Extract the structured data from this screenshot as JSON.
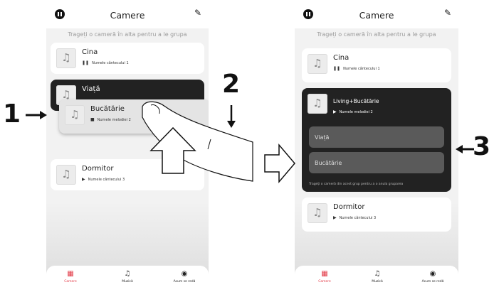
{
  "left": {
    "header_title": "Camere",
    "hint": "Trageți o cameră în alta pentru a le grupa",
    "cards": [
      {
        "name": "Cina",
        "sub_icon": "pause",
        "subtitle": "Numele cântecului 1"
      },
      {
        "name": "Viață",
        "sub_icon": "pause",
        "subtitle": ""
      },
      {
        "name": "Bucătărie",
        "sub_icon": "stop",
        "subtitle": "Numele melodiei 2"
      },
      {
        "name": "Dormitor",
        "sub_icon": "play",
        "subtitle": "Numele cântecului 3"
      }
    ],
    "tabs": [
      {
        "label": "Camere",
        "icon": "rooms-icon"
      },
      {
        "label": "Muzică",
        "icon": "music-icon"
      },
      {
        "label": "Acum se redă",
        "icon": "now-playing-icon"
      }
    ]
  },
  "right": {
    "header_title": "Camere",
    "hint": "Trageți o cameră în alta pentru a le grupa",
    "cards": [
      {
        "name": "Cina",
        "sub_icon": "pause",
        "subtitle": "Numele cântecului 1"
      },
      {
        "name": "Living+Bucătărie",
        "sub_icon": "play",
        "subtitle": "Numele melodiei 2"
      },
      {
        "name": "Dormitor",
        "sub_icon": "play",
        "subtitle": "Numele cântecului 3"
      }
    ],
    "group_rooms": [
      "Viață",
      "Bucătărie"
    ],
    "group_hint": "Trageți o cameră din acest grup pentru a o anula gruparea",
    "tabs": [
      {
        "label": "Camere",
        "icon": "rooms-icon"
      },
      {
        "label": "Muzică",
        "icon": "music-icon"
      },
      {
        "label": "Acum se redă",
        "icon": "now-playing-icon"
      }
    ]
  },
  "steps": [
    "1",
    "2",
    "3"
  ],
  "colors": {
    "accent": "#e23744",
    "dark_card": "#222222",
    "sub_item": "#5a5a5a"
  }
}
